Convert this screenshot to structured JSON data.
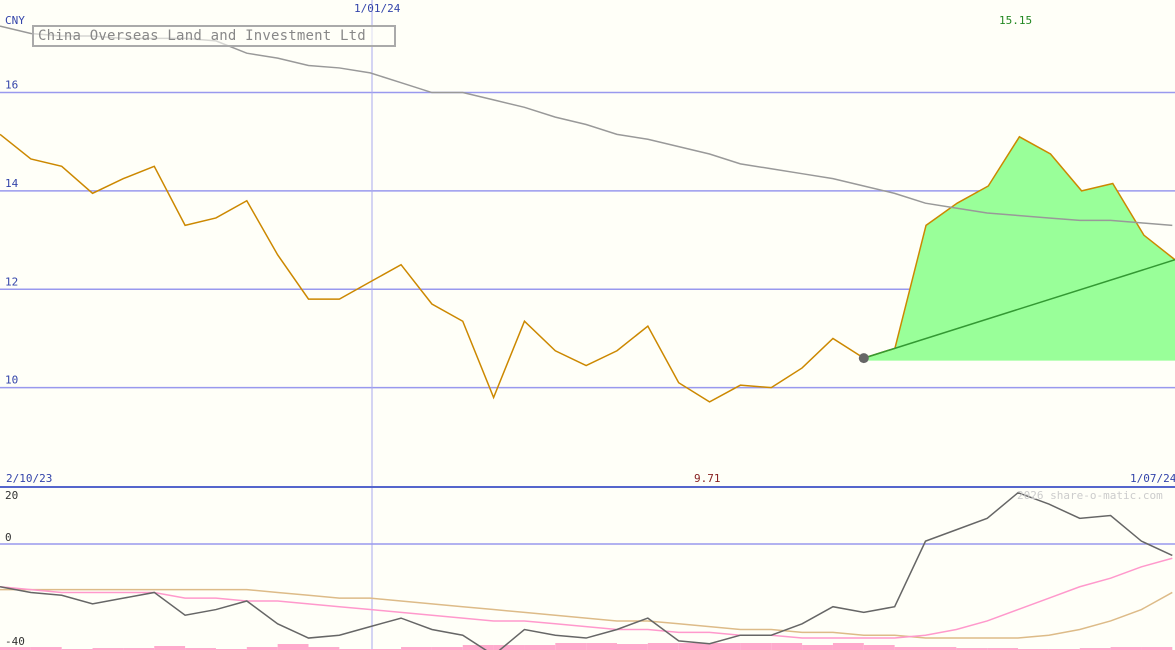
{
  "chart_data": [
    {
      "type": "line",
      "title": "China Overseas Land and Investment Ltd",
      "currency": "CNY",
      "ylim": [
        8,
        17.8
      ],
      "yticks": [
        10,
        12,
        14,
        16
      ],
      "date_labels": {
        "start": "2/10/23",
        "mid": "1/01/24",
        "end": "1/07/24"
      },
      "max_label": "15.15",
      "min_label": "9.71",
      "colors": {
        "price": "#cc8800",
        "moving_avg": "#999999",
        "forecast_fill": "#99ff99",
        "forecast_line": "#339933",
        "grid": "#9999ee"
      },
      "price": [
        15.15,
        14.65,
        14.5,
        13.95,
        14.25,
        14.5,
        13.3,
        13.45,
        13.8,
        12.7,
        11.8,
        11.8,
        12.15,
        12.5,
        11.7,
        11.35,
        9.8,
        11.35,
        10.75,
        10.45,
        10.75,
        11.25,
        10.1,
        9.71,
        10.05,
        10.0,
        10.4,
        11.0,
        10.6
      ],
      "moving_avg": [
        17.35,
        17.2,
        17.15,
        17.15,
        17.1,
        17.1,
        17.1,
        17.05,
        16.8,
        16.7,
        16.55,
        16.5,
        16.4,
        16.2,
        16.0,
        16.0,
        15.85,
        15.7,
        15.5,
        15.35,
        15.15,
        15.05,
        14.9,
        14.75,
        14.55,
        14.45,
        14.35,
        14.25,
        14.1,
        13.95,
        13.75,
        13.65,
        13.55,
        13.5,
        13.45,
        13.4,
        13.4,
        13.35,
        13.3
      ],
      "forecast_upper": [
        10.6,
        10.8,
        13.3,
        13.75,
        14.1,
        15.1,
        14.75,
        14.0,
        14.15,
        13.1,
        12.6
      ],
      "forecast_base": 10.55,
      "trend_line": [
        10.6,
        12.6
      ]
    },
    {
      "type": "line",
      "ylim": [
        -40,
        20
      ],
      "yticks": [
        20,
        0,
        -40
      ],
      "credit": "2026 share-o-matic.com",
      "colors": {
        "momentum": "#666666",
        "signal_pink": "#ff99cc",
        "signal_tan": "#ddbb88",
        "volume": "#ffaacc"
      },
      "momentum": [
        -15,
        -17,
        -18,
        -21,
        -19,
        -17,
        -25,
        -23,
        -20,
        -28,
        -33,
        -32,
        -29,
        -26,
        -30,
        -32,
        -39,
        -30,
        -32,
        -33,
        -30,
        -26,
        -34,
        -35,
        -32,
        -32,
        -28,
        -22,
        -24,
        -22,
        1,
        5,
        9,
        18,
        14,
        9,
        10,
        1,
        -4
      ],
      "signal_pink": [
        -15,
        -16,
        -17,
        -17,
        -17,
        -17,
        -19,
        -19,
        -20,
        -20,
        -21,
        -22,
        -23,
        -24,
        -25,
        -26,
        -27,
        -27,
        -28,
        -29,
        -30,
        -30,
        -31,
        -31,
        -32,
        -32,
        -33,
        -33,
        -33,
        -33,
        -32,
        -30,
        -27,
        -23,
        -19,
        -15,
        -12,
        -8,
        -5
      ],
      "signal_tan": [
        -16,
        -16,
        -16,
        -16,
        -16,
        -16,
        -16,
        -16,
        -16,
        -17,
        -18,
        -19,
        -19,
        -20,
        -21,
        -22,
        -23,
        -24,
        -25,
        -26,
        -27,
        -27,
        -28,
        -29,
        -30,
        -30,
        -31,
        -31,
        -32,
        -32,
        -33,
        -33,
        -33,
        -33,
        -32,
        -30,
        -27,
        -23,
        -17
      ],
      "volume": [
        1.5,
        1.5,
        0.5,
        1.0,
        1.0,
        2.0,
        1.0,
        0.5,
        1.5,
        3.0,
        1.5,
        0.5,
        0.5,
        1.5,
        1.5,
        2.5,
        2.5,
        2.5,
        3.5,
        3.5,
        3.0,
        3.5,
        3.5,
        3.5,
        3.5,
        3.5,
        2.5,
        3.5,
        2.5,
        1.5,
        1.5,
        1.0,
        1.0,
        0.5,
        0.5,
        1.0,
        1.5,
        1.5
      ]
    }
  ]
}
